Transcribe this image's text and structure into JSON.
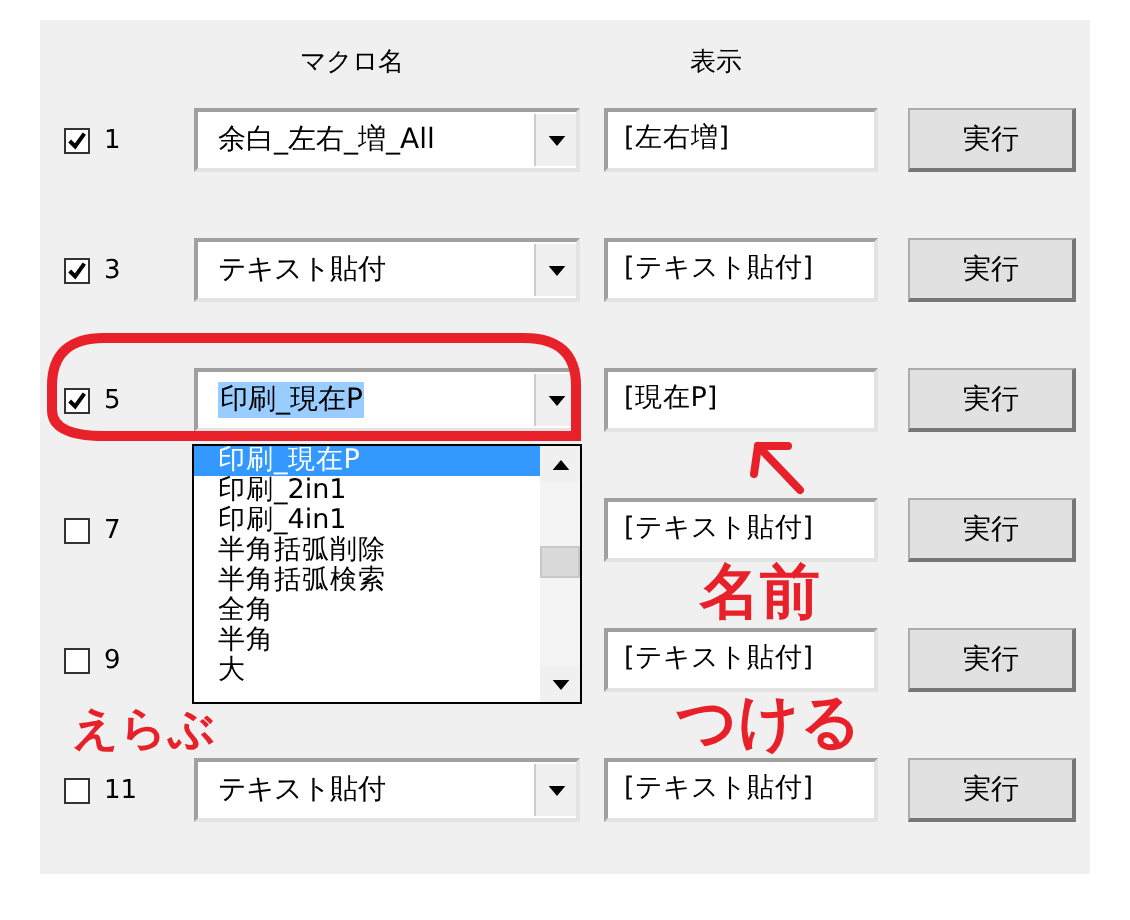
{
  "headers": {
    "macro": "マクロ名",
    "display": "表示"
  },
  "rows": [
    {
      "number": "1",
      "checked": true,
      "macro": "余白_左右_増_All",
      "display": "[左右増]",
      "button": "実行"
    },
    {
      "number": "3",
      "checked": true,
      "macro": "テキスト貼付",
      "display": "[テキスト貼付]",
      "button": "実行"
    },
    {
      "number": "5",
      "checked": true,
      "macro": "印刷_現在P",
      "macro_selected": true,
      "display": "[現在P]",
      "button": "実行",
      "dropdown": [
        {
          "label": "印刷_現在P",
          "selected": true
        },
        {
          "label": "印刷_2in1",
          "selected": false
        },
        {
          "label": "印刷_4in1",
          "selected": false
        },
        {
          "label": "半角括弧削除",
          "selected": false
        },
        {
          "label": "半角括弧検索",
          "selected": false
        },
        {
          "label": "全角",
          "selected": false
        },
        {
          "label": "半角",
          "selected": false
        },
        {
          "label": "大",
          "selected": false
        }
      ]
    },
    {
      "number": "7",
      "checked": false,
      "display": "[テキスト貼付]",
      "button": "実行"
    },
    {
      "number": "9",
      "checked": false,
      "display": "[テキスト貼付]",
      "button": "実行"
    },
    {
      "number": "11",
      "checked": false,
      "macro": "テキスト貼付",
      "display": "[テキスト貼付]",
      "button": "実行"
    }
  ],
  "annotations": [
    {
      "kind": "circle"
    },
    {
      "kind": "text",
      "text": "えらぶ"
    },
    {
      "kind": "arrow"
    },
    {
      "kind": "text",
      "text": "名前"
    },
    {
      "kind": "text",
      "text": "つける"
    }
  ]
}
